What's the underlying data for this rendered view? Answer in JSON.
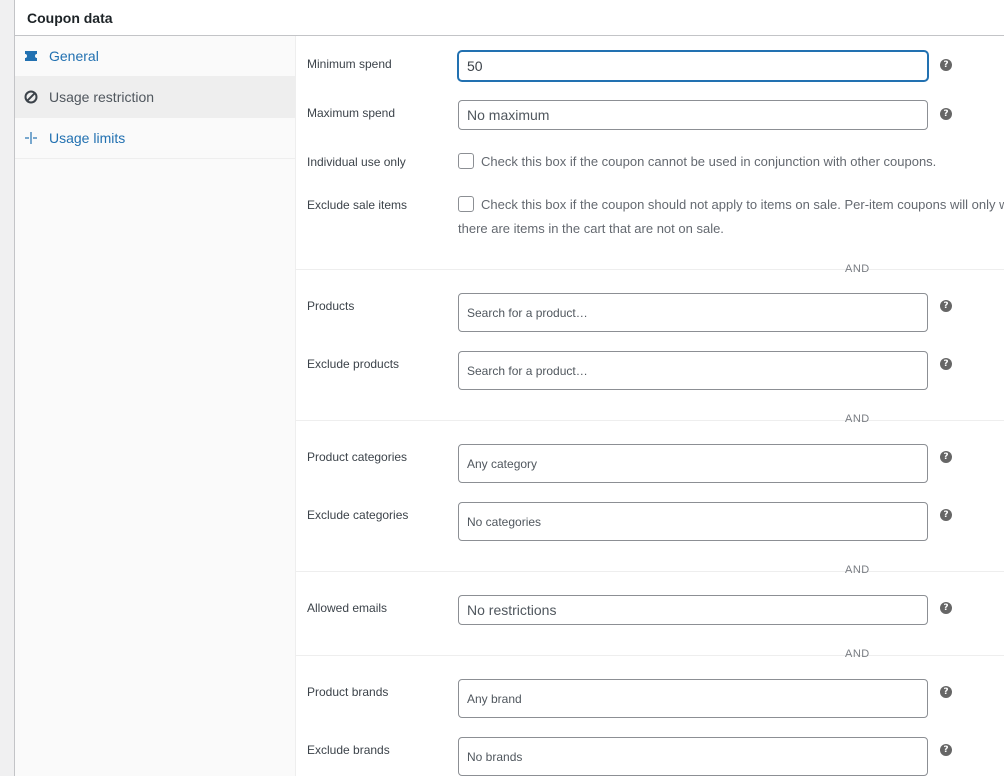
{
  "panel": {
    "title": "Coupon data"
  },
  "tabs": [
    {
      "label": "General",
      "icon": "ticket-icon",
      "active": false
    },
    {
      "label": "Usage restriction",
      "icon": "block-icon",
      "active": true
    },
    {
      "label": "Usage limits",
      "icon": "crosshair-icon",
      "active": false
    }
  ],
  "fields": {
    "minimum_spend": {
      "label": "Minimum spend",
      "value": "50"
    },
    "maximum_spend": {
      "label": "Maximum spend",
      "placeholder": "No maximum"
    },
    "individual_use": {
      "label": "Individual use only",
      "description": "Check this box if the coupon cannot be used in conjunction with other coupons."
    },
    "exclude_sale": {
      "label": "Exclude sale items",
      "description": "Check this box if the coupon should not apply to items on sale. Per-item coupons will only w",
      "description_line2": "there are items in the cart that are not on sale."
    },
    "products": {
      "label": "Products",
      "placeholder": "Search for a product…"
    },
    "exclude_products": {
      "label": "Exclude products",
      "placeholder": "Search for a product…"
    },
    "product_categories": {
      "label": "Product categories",
      "placeholder": "Any category"
    },
    "exclude_categories": {
      "label": "Exclude categories",
      "placeholder": "No categories"
    },
    "allowed_emails": {
      "label": "Allowed emails",
      "placeholder": "No restrictions"
    },
    "product_brands": {
      "label": "Product brands",
      "placeholder": "Any brand"
    },
    "exclude_brands": {
      "label": "Exclude brands",
      "placeholder": "No brands"
    }
  },
  "separator_text": "AND",
  "help_glyph": "?",
  "colors": {
    "link": "#2271b1",
    "focus": "#2271b1",
    "help": "#666666"
  }
}
